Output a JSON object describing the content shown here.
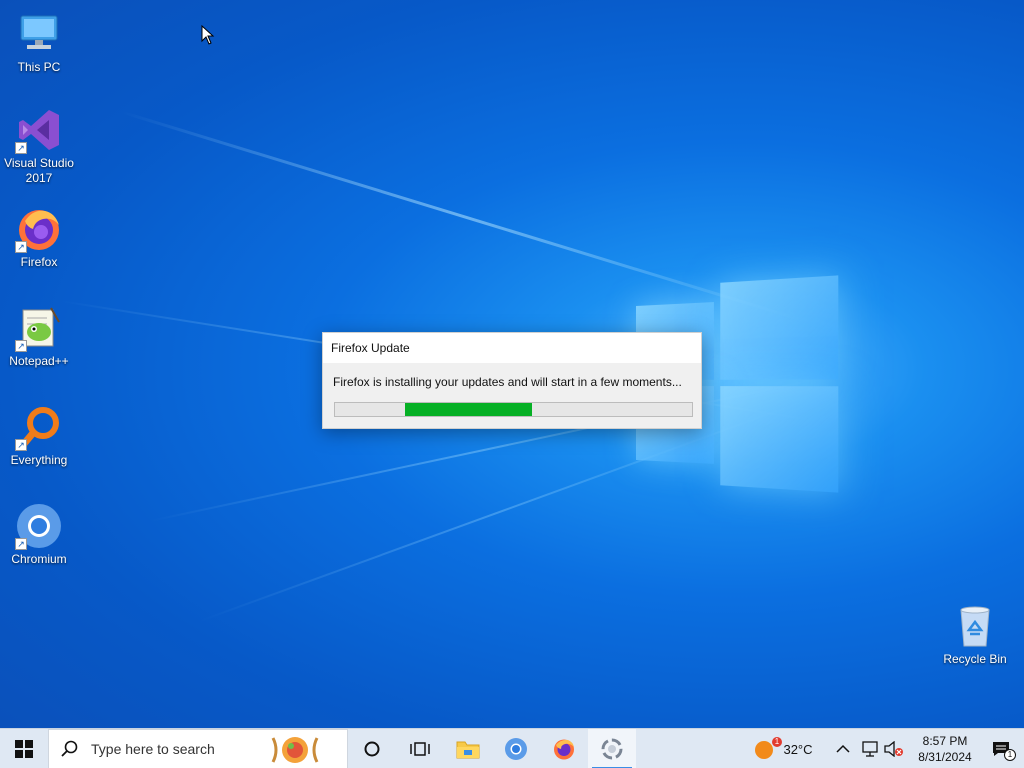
{
  "desktop": {
    "icons": [
      {
        "label": "This PC",
        "icon": "computer-icon"
      },
      {
        "label": "Visual Studio 2017",
        "icon": "visual-studio-icon"
      },
      {
        "label": "Firefox",
        "icon": "firefox-icon"
      },
      {
        "label": "Notepad++",
        "icon": "notepad-plus-plus-icon"
      },
      {
        "label": "Everything",
        "icon": "everything-search-icon"
      },
      {
        "label": "Chromium",
        "icon": "chromium-icon"
      },
      {
        "label": "Recycle Bin",
        "icon": "recycle-bin-icon"
      }
    ]
  },
  "dialog": {
    "title": "Firefox Update",
    "message": "Firefox is installing your updates and will start in a few moments...",
    "progress_state": "indeterminate"
  },
  "taskbar": {
    "search_placeholder": "Type here to search",
    "pinned": [
      "file-explorer-icon",
      "chromium-icon",
      "firefox-icon",
      "firefox-updater-icon"
    ],
    "weather": {
      "temp": "32°C",
      "badge": "1"
    },
    "clock": {
      "time": "8:57 PM",
      "date": "8/31/2024"
    },
    "notification_count": "1"
  },
  "colors": {
    "progress": "#06b025",
    "desktop_bg": "#0b6fe0",
    "taskbar_bg": "#dfe8f3"
  }
}
